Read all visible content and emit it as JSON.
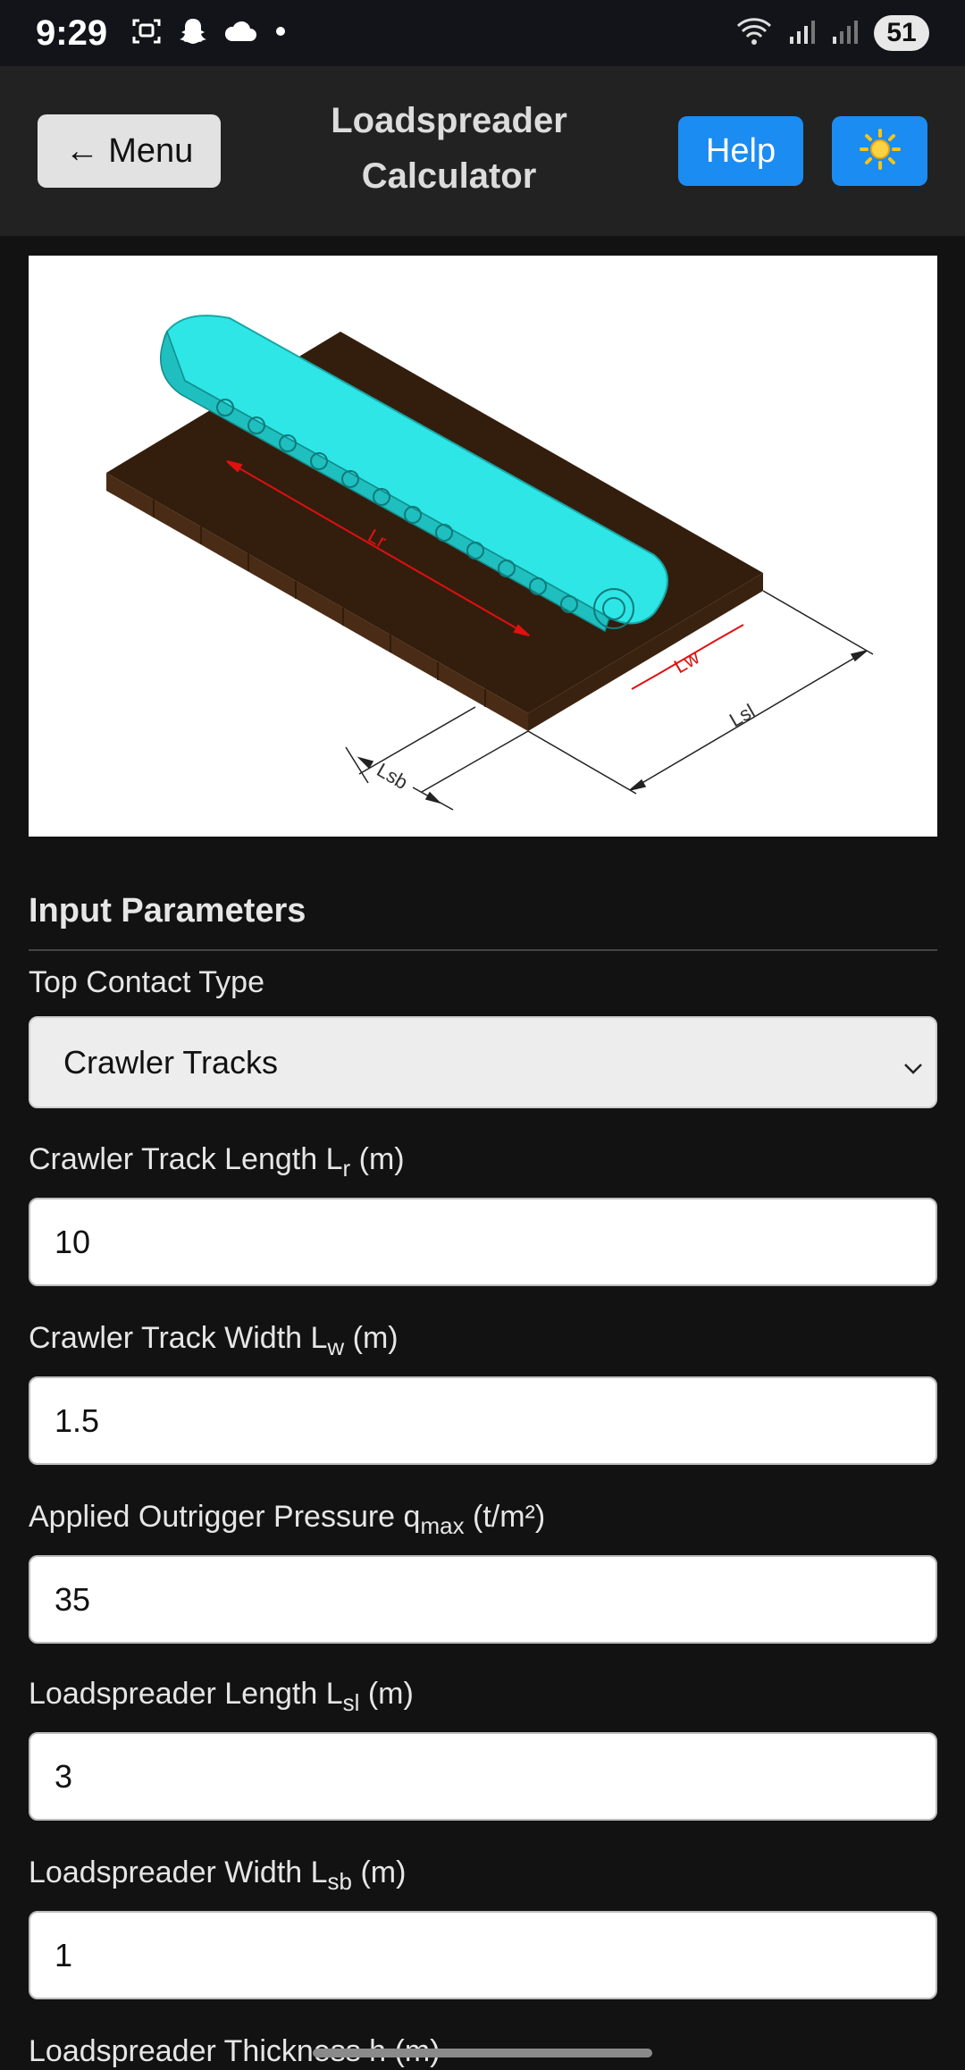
{
  "status_bar": {
    "time": "9:29",
    "battery": "51",
    "icons_left": [
      "screenshot-icon",
      "snapchat-icon",
      "cloud-icon",
      "dot-icon"
    ],
    "icons_right": [
      "wifi-icon",
      "signal-icon",
      "signal-icon-2",
      "battery-icon"
    ]
  },
  "header": {
    "menu_label": "← Menu",
    "title_line1": "Loadspreader",
    "title_line2": "Calculator",
    "help_label": "Help",
    "theme_icon": "sun-icon"
  },
  "diagram": {
    "labels": {
      "lr": "Lr",
      "lw": "Lw",
      "lsl": "Lsl",
      "lsb": "Lsb"
    },
    "colors": {
      "track": "#2ee6e6",
      "mat": "#3a2414",
      "dimension": "#e01010"
    }
  },
  "form": {
    "section_title": "Input Parameters",
    "top_contact": {
      "label": "Top Contact Type",
      "value": "Crawler Tracks"
    },
    "track_length": {
      "label": "Crawler Track Length L",
      "sub": "r",
      "unit": " (m)",
      "value": "10"
    },
    "track_width": {
      "label": "Crawler Track Width L",
      "sub": "w",
      "unit": " (m)",
      "value": "1.5"
    },
    "pressure": {
      "label": "Applied Outrigger Pressure q",
      "sub": "max",
      "unit": " (t/m²)",
      "value": "35"
    },
    "spreader_length": {
      "label": "Loadspreader Length L",
      "sub": "sl",
      "unit": " (m)",
      "value": "3"
    },
    "spreader_width": {
      "label": "Loadspreader Width L",
      "sub": "sb",
      "unit": " (m)",
      "value": "1"
    },
    "thickness": {
      "label": "Loadspreader Thickness h (m)"
    }
  },
  "colors": {
    "accent": "#1b8cf2",
    "background": "#121212",
    "header": "#222222"
  }
}
